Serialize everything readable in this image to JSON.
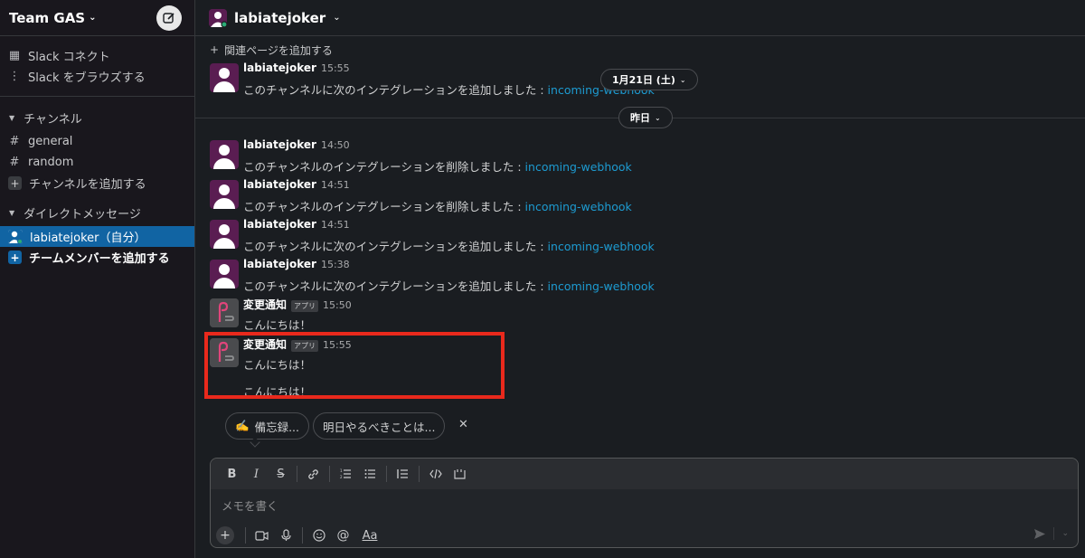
{
  "workspace": {
    "name": "Team GAS"
  },
  "sidebar": {
    "top_items": [
      {
        "label": "Slack コネクト"
      },
      {
        "label": "Slack をブラウズする"
      }
    ],
    "channels_heading": "チャンネル",
    "channels": [
      {
        "label": "general"
      },
      {
        "label": "random"
      }
    ],
    "add_channel": "チャンネルを追加する",
    "dm_heading": "ダイレクトメッセージ",
    "dms": [
      {
        "label": "labiatejoker（自分）"
      }
    ],
    "add_member": "チームメンバーを追加する"
  },
  "channel": {
    "title": "labiatejoker",
    "add_bookmark": "関連ページを追加する"
  },
  "dates": {
    "first": "1月21日 (土)",
    "second": "昨日"
  },
  "messages": [
    {
      "author": "labiatejoker",
      "time": "15:55",
      "text": "このチャンネルに次のインテグレーションを追加しました :",
      "link": "incoming-webhook"
    },
    {
      "author": "labiatejoker",
      "time": "14:50",
      "text": "このチャンネルのインテグレーションを削除しました :",
      "link": "incoming-webhook"
    },
    {
      "author": "labiatejoker",
      "time": "14:51",
      "text": "このチャンネルのインテグレーションを削除しました :",
      "link": "incoming-webhook"
    },
    {
      "author": "labiatejoker",
      "time": "14:51",
      "text": "このチャンネルに次のインテグレーションを追加しました :",
      "link": "incoming-webhook"
    },
    {
      "author": "labiatejoker",
      "time": "15:38",
      "text": "このチャンネルに次のインテグレーションを追加しました :",
      "link": "incoming-webhook"
    }
  ],
  "app_messages": [
    {
      "author": "変更通知",
      "badge": "アプリ",
      "time": "15:50",
      "lines": [
        "こんにちは！"
      ]
    },
    {
      "author": "変更通知",
      "badge": "アプリ",
      "time": "15:55",
      "lines": [
        "こんにちは！",
        "こんにちは！"
      ]
    }
  ],
  "suggestions": [
    {
      "emoji": "✍️",
      "label": "備忘録..."
    },
    {
      "label": "明日やるべきことは..."
    }
  ],
  "composer": {
    "placeholder": "メモを書く",
    "format_label": "Aa"
  }
}
